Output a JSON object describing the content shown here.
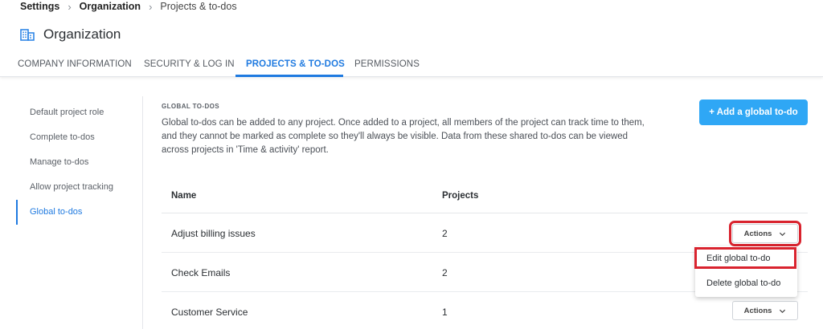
{
  "breadcrumb": {
    "items": [
      "Settings",
      "Organization",
      "Projects & to-dos"
    ]
  },
  "page": {
    "title": "Organization",
    "icon": "building-icon"
  },
  "tabs": [
    {
      "label": "COMPANY INFORMATION",
      "active": false
    },
    {
      "label": "SECURITY & LOG IN",
      "active": false
    },
    {
      "label": "PROJECTS & TO-DOS",
      "active": true
    },
    {
      "label": "PERMISSIONS",
      "active": false
    }
  ],
  "sidebar": {
    "items": [
      {
        "label": "Default project role",
        "active": false
      },
      {
        "label": "Complete to-dos",
        "active": false
      },
      {
        "label": "Manage to-dos",
        "active": false
      },
      {
        "label": "Allow project tracking",
        "active": false
      },
      {
        "label": "Global to-dos",
        "active": true
      }
    ]
  },
  "section": {
    "label": "GLOBAL TO-DOS",
    "description": "Global to-dos can be added to any project. Once added to a project, all members of the project can track time to them, and they cannot be marked as complete so they'll always be visible. Data from these shared to-dos can be viewed across projects in 'Time & activity' report.",
    "add_button": "+ Add a global to-do"
  },
  "table": {
    "headers": [
      "Name",
      "Projects"
    ],
    "rows": [
      {
        "name": "Adjust billing issues",
        "projects": "2",
        "actions": "Actions"
      },
      {
        "name": "Check Emails",
        "projects": "2",
        "actions": "Actions"
      },
      {
        "name": "Customer Service",
        "projects": "1",
        "actions": "Actions"
      }
    ]
  },
  "dropdown": {
    "items": [
      "Edit global to-do",
      "Delete global to-do"
    ]
  },
  "colors": {
    "accent": "#1f7ae0",
    "button": "#2fa7f5",
    "highlight": "#d9232e"
  }
}
